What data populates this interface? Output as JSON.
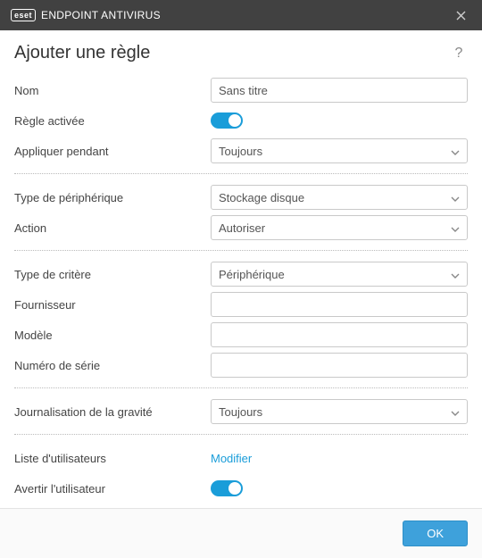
{
  "titlebar": {
    "brand_badge": "eset",
    "product": "ENDPOINT ANTIVIRUS"
  },
  "page": {
    "title": "Ajouter une règle"
  },
  "fields": {
    "name_label": "Nom",
    "name_value": "Sans titre",
    "rule_enabled_label": "Règle activée",
    "apply_during_label": "Appliquer pendant",
    "apply_during_value": "Toujours",
    "device_type_label": "Type de périphérique",
    "device_type_value": "Stockage disque",
    "action_label": "Action",
    "action_value": "Autoriser",
    "criteria_type_label": "Type de critère",
    "criteria_type_value": "Périphérique",
    "vendor_label": "Fournisseur",
    "vendor_value": "",
    "model_label": "Modèle",
    "model_value": "",
    "serial_label": "Numéro de série",
    "serial_value": "",
    "severity_log_label": "Journalisation de la gravité",
    "severity_log_value": "Toujours",
    "user_list_label": "Liste d'utilisateurs",
    "user_list_link": "Modifier",
    "notify_user_label": "Avertir l'utilisateur"
  },
  "footer": {
    "ok_label": "OK"
  }
}
